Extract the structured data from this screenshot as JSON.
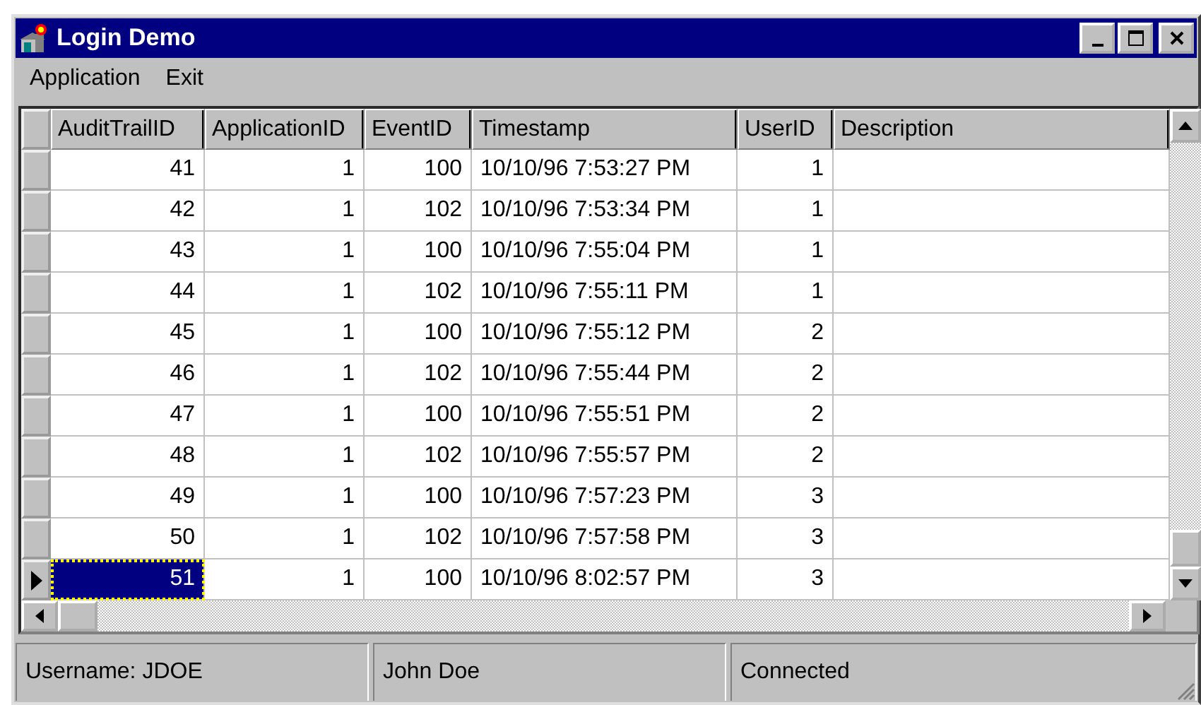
{
  "window": {
    "title": "Login Demo"
  },
  "menu": [
    "Application",
    "Exit"
  ],
  "table": {
    "columns": [
      "AuditTrailID",
      "ApplicationID",
      "EventID",
      "Timestamp",
      "UserID",
      "Description"
    ],
    "rows": [
      {
        "cells": [
          "41",
          "1",
          "100",
          "10/10/96 7:53:27 PM",
          "1"
        ],
        "selected": false
      },
      {
        "cells": [
          "42",
          "1",
          "102",
          "10/10/96 7:53:34 PM",
          "1"
        ],
        "selected": false
      },
      {
        "cells": [
          "43",
          "1",
          "100",
          "10/10/96 7:55:04 PM",
          "1"
        ],
        "selected": false
      },
      {
        "cells": [
          "44",
          "1",
          "102",
          "10/10/96 7:55:11 PM",
          "1"
        ],
        "selected": false
      },
      {
        "cells": [
          "45",
          "1",
          "100",
          "10/10/96 7:55:12 PM",
          "2"
        ],
        "selected": false
      },
      {
        "cells": [
          "46",
          "1",
          "102",
          "10/10/96 7:55:44 PM",
          "2"
        ],
        "selected": false
      },
      {
        "cells": [
          "47",
          "1",
          "100",
          "10/10/96 7:55:51 PM",
          "2"
        ],
        "selected": false
      },
      {
        "cells": [
          "48",
          "1",
          "102",
          "10/10/96 7:55:57 PM",
          "2"
        ],
        "selected": false
      },
      {
        "cells": [
          "49",
          "1",
          "100",
          "10/10/96 7:57:23 PM",
          "3"
        ],
        "selected": false
      },
      {
        "cells": [
          "50",
          "1",
          "102",
          "10/10/96 7:57:58 PM",
          "3"
        ],
        "selected": false
      },
      {
        "cells": [
          "51",
          "1",
          "100",
          "10/10/96 8:02:57 PM",
          "3"
        ],
        "selected": true
      }
    ]
  },
  "status_bar": [
    "Username: JDOE",
    "John Doe",
    "Connected"
  ]
}
